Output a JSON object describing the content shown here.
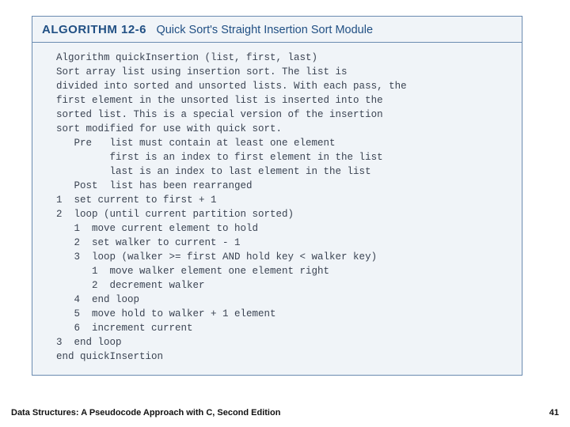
{
  "header": {
    "number": "ALGORITHM 12-6",
    "title": "Quick Sort's Straight Insertion Sort Module"
  },
  "code": [
    "Algorithm quickInsertion (list, first, last)",
    "Sort array list using insertion sort. The list is",
    "divided into sorted and unsorted lists. With each pass, the",
    "first element in the unsorted list is inserted into the",
    "sorted list. This is a special version of the insertion",
    "sort modified for use with quick sort.",
    "   Pre   list must contain at least one element",
    "         first is an index to first element in the list",
    "         last is an index to last element in the list",
    "   Post  list has been rearranged",
    "1  set current to first + 1",
    "2  loop (until current partition sorted)",
    "   1  move current element to hold",
    "   2  set walker to current - 1",
    "   3  loop (walker >= first AND hold key < walker key)",
    "      1  move walker element one element right",
    "      2  decrement walker",
    "   4  end loop",
    "   5  move hold to walker + 1 element",
    "   6  increment current",
    "3  end loop",
    "end quickInsertion"
  ],
  "footer": {
    "book": "Data Structures: A Pseudocode Approach with C, Second Edition",
    "page": "41"
  }
}
